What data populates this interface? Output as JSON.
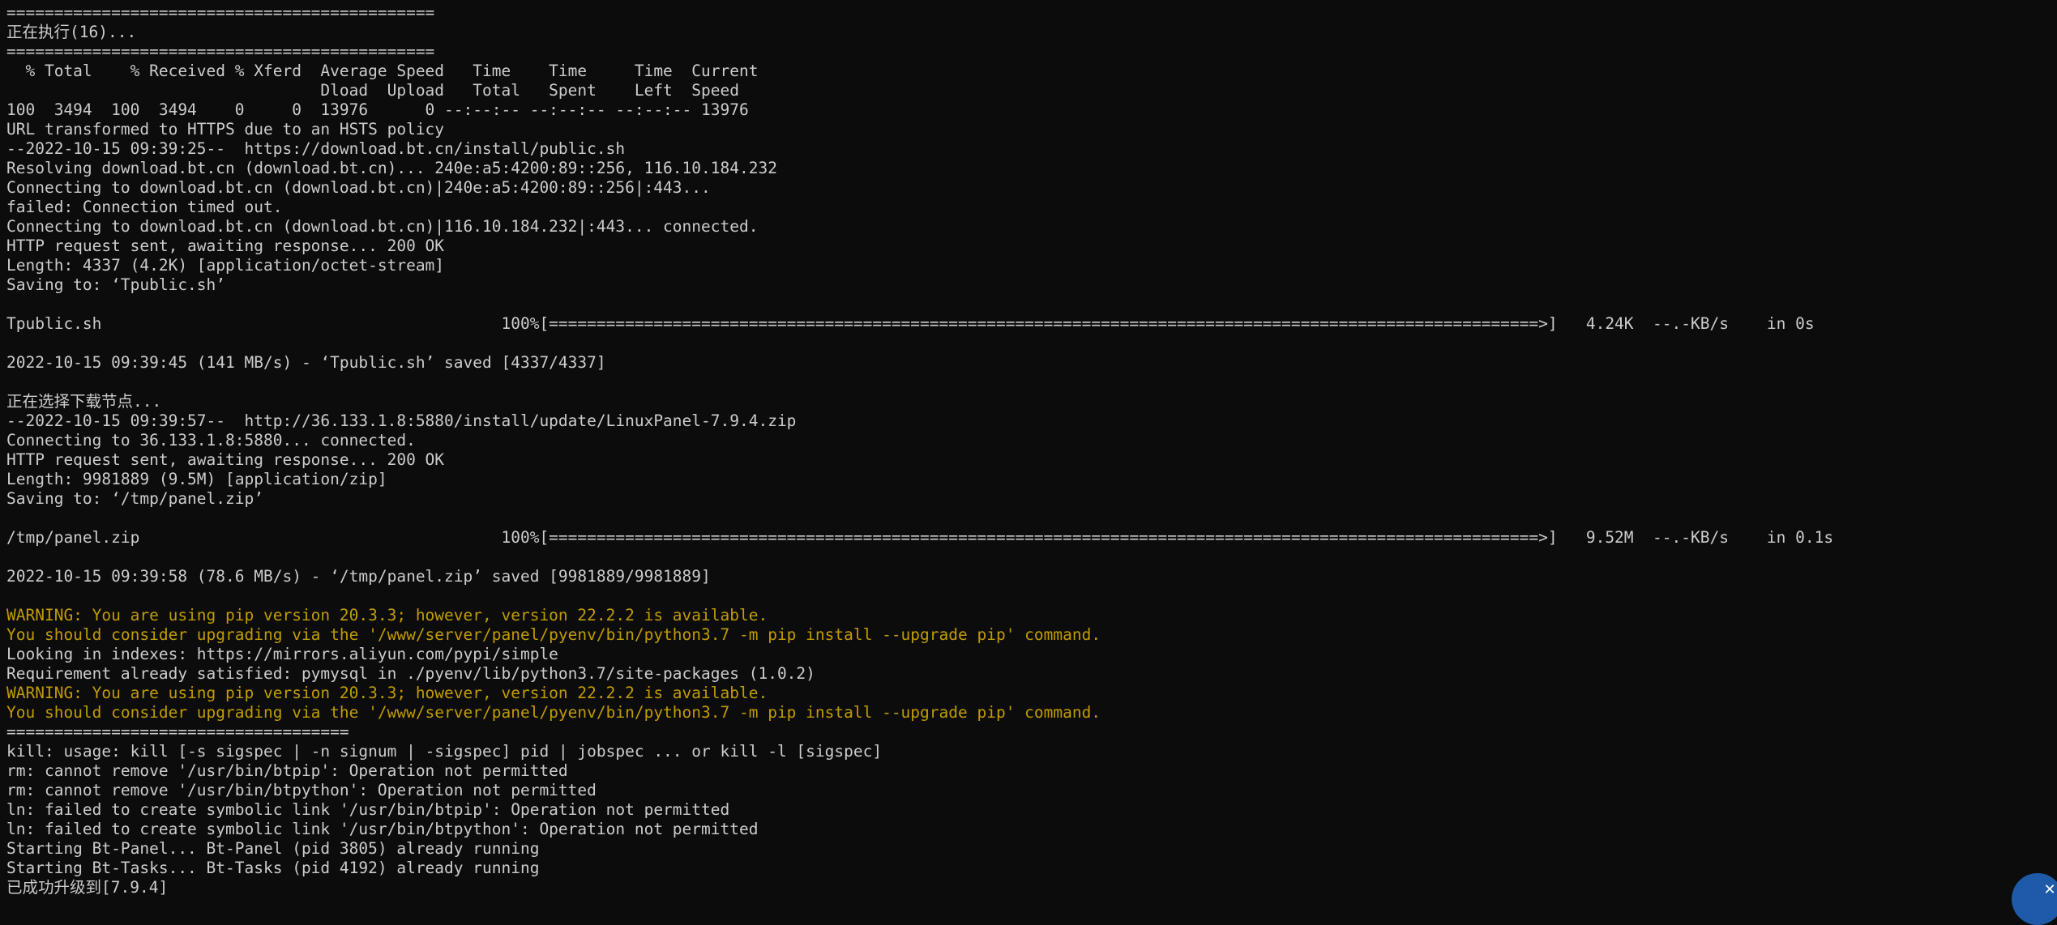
{
  "terminal": {
    "lines": [
      {
        "text": "=============================================",
        "type": "normal"
      },
      {
        "text": "正在执行(16)...",
        "type": "normal"
      },
      {
        "text": "=============================================",
        "type": "normal"
      },
      {
        "text": "  % Total    % Received % Xferd  Average Speed   Time    Time     Time  Current",
        "type": "normal"
      },
      {
        "text": "                                 Dload  Upload   Total   Spent    Left  Speed",
        "type": "normal"
      },
      {
        "text": "100  3494  100  3494    0     0  13976      0 --:--:-- --:--:-- --:--:-- 13976",
        "type": "normal"
      },
      {
        "text": "URL transformed to HTTPS due to an HSTS policy",
        "type": "normal"
      },
      {
        "text": "--2022-10-15 09:39:25--  https://download.bt.cn/install/public.sh",
        "type": "normal"
      },
      {
        "text": "Resolving download.bt.cn (download.bt.cn)... 240e:a5:4200:89::256, 116.10.184.232",
        "type": "normal"
      },
      {
        "text": "Connecting to download.bt.cn (download.bt.cn)|240e:a5:4200:89::256|:443...",
        "type": "normal"
      },
      {
        "text": "failed: Connection timed out.",
        "type": "normal"
      },
      {
        "text": "Connecting to download.bt.cn (download.bt.cn)|116.10.184.232|:443... connected.",
        "type": "normal"
      },
      {
        "text": "HTTP request sent, awaiting response... 200 OK",
        "type": "normal"
      },
      {
        "text": "Length: 4337 (4.2K) [application/octet-stream]",
        "type": "normal"
      },
      {
        "text": "Saving to: ‘Tpublic.sh’",
        "type": "normal"
      },
      {
        "text": "",
        "type": "normal"
      },
      {
        "text": "Tpublic.sh                                          100%[========================================================================================================>]   4.24K  --.-KB/s    in 0s",
        "type": "normal"
      },
      {
        "text": "",
        "type": "normal"
      },
      {
        "text": "2022-10-15 09:39:45 (141 MB/s) - ‘Tpublic.sh’ saved [4337/4337]",
        "type": "normal"
      },
      {
        "text": "",
        "type": "normal"
      },
      {
        "text": "正在选择下载节点...",
        "type": "normal"
      },
      {
        "text": "--2022-10-15 09:39:57--  http://36.133.1.8:5880/install/update/LinuxPanel-7.9.4.zip",
        "type": "normal"
      },
      {
        "text": "Connecting to 36.133.1.8:5880... connected.",
        "type": "normal"
      },
      {
        "text": "HTTP request sent, awaiting response... 200 OK",
        "type": "normal"
      },
      {
        "text": "Length: 9981889 (9.5M) [application/zip]",
        "type": "normal"
      },
      {
        "text": "Saving to: ‘/tmp/panel.zip’",
        "type": "normal"
      },
      {
        "text": "",
        "type": "normal"
      },
      {
        "text": "/tmp/panel.zip                                      100%[========================================================================================================>]   9.52M  --.-KB/s    in 0.1s",
        "type": "normal"
      },
      {
        "text": "",
        "type": "normal"
      },
      {
        "text": "2022-10-15 09:39:58 (78.6 MB/s) - ‘/tmp/panel.zip’ saved [9981889/9981889]",
        "type": "normal"
      },
      {
        "text": "",
        "type": "normal"
      },
      {
        "text": "WARNING: You are using pip version 20.3.3; however, version 22.2.2 is available.",
        "type": "warn"
      },
      {
        "text": "You should consider upgrading via the '/www/server/panel/pyenv/bin/python3.7 -m pip install --upgrade pip' command.",
        "type": "warn"
      },
      {
        "text": "Looking in indexes: https://mirrors.aliyun.com/pypi/simple",
        "type": "normal"
      },
      {
        "text": "Requirement already satisfied: pymysql in ./pyenv/lib/python3.7/site-packages (1.0.2)",
        "type": "normal"
      },
      {
        "text": "WARNING: You are using pip version 20.3.3; however, version 22.2.2 is available.",
        "type": "warn"
      },
      {
        "text": "You should consider upgrading via the '/www/server/panel/pyenv/bin/python3.7 -m pip install --upgrade pip' command.",
        "type": "warn"
      },
      {
        "text": "====================================",
        "type": "normal"
      },
      {
        "text": "kill: usage: kill [-s sigspec | -n signum | -sigspec] pid | jobspec ... or kill -l [sigspec]",
        "type": "normal"
      },
      {
        "text": "rm: cannot remove '/usr/bin/btpip': Operation not permitted",
        "type": "normal"
      },
      {
        "text": "rm: cannot remove '/usr/bin/btpython': Operation not permitted",
        "type": "normal"
      },
      {
        "text": "ln: failed to create symbolic link '/usr/bin/btpip': Operation not permitted",
        "type": "normal"
      },
      {
        "text": "ln: failed to create symbolic link '/usr/bin/btpython': Operation not permitted",
        "type": "normal"
      },
      {
        "text": "Starting Bt-Panel... Bt-Panel (pid 3805) already running",
        "type": "normal"
      },
      {
        "text": "Starting Bt-Tasks... Bt-Tasks (pid 4192) already running",
        "type": "normal"
      },
      {
        "text": "已成功升级到[7.9.4]",
        "type": "normal"
      }
    ]
  },
  "corner_widget": {
    "close_glyph": "✕",
    "icon": "close-icon",
    "color": "#1e5aa8"
  }
}
